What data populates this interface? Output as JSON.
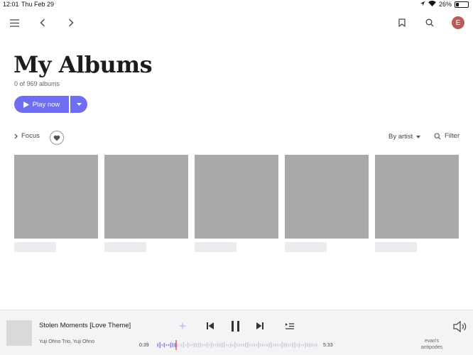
{
  "status": {
    "time": "12:01",
    "date": "Thu Feb 29",
    "battery": "26%",
    "battery_level": 0.26
  },
  "page": {
    "title": "My Albums",
    "subtitle": "0 of 969 albums"
  },
  "actions": {
    "play_label": "Play now"
  },
  "toolbar": {
    "focus_label": "Focus",
    "sort_label": "By artist",
    "filter_label": "Filter"
  },
  "user": {
    "initial": "E"
  },
  "albums": {
    "placeholder_count": 5
  },
  "player": {
    "title": "Stolen Moments [Love Theme]",
    "artist": "Yuji Ohno Trio, Yuji Ohno",
    "elapsed": "0:39",
    "duration": "5:33",
    "progress": 0.117,
    "zone": "evan's antipodes"
  },
  "colors": {
    "accent": "#6f6ef1",
    "avatar": "#b85a57",
    "placeholder": "#a9a9a9",
    "caption_placeholder": "#ebebf0"
  }
}
